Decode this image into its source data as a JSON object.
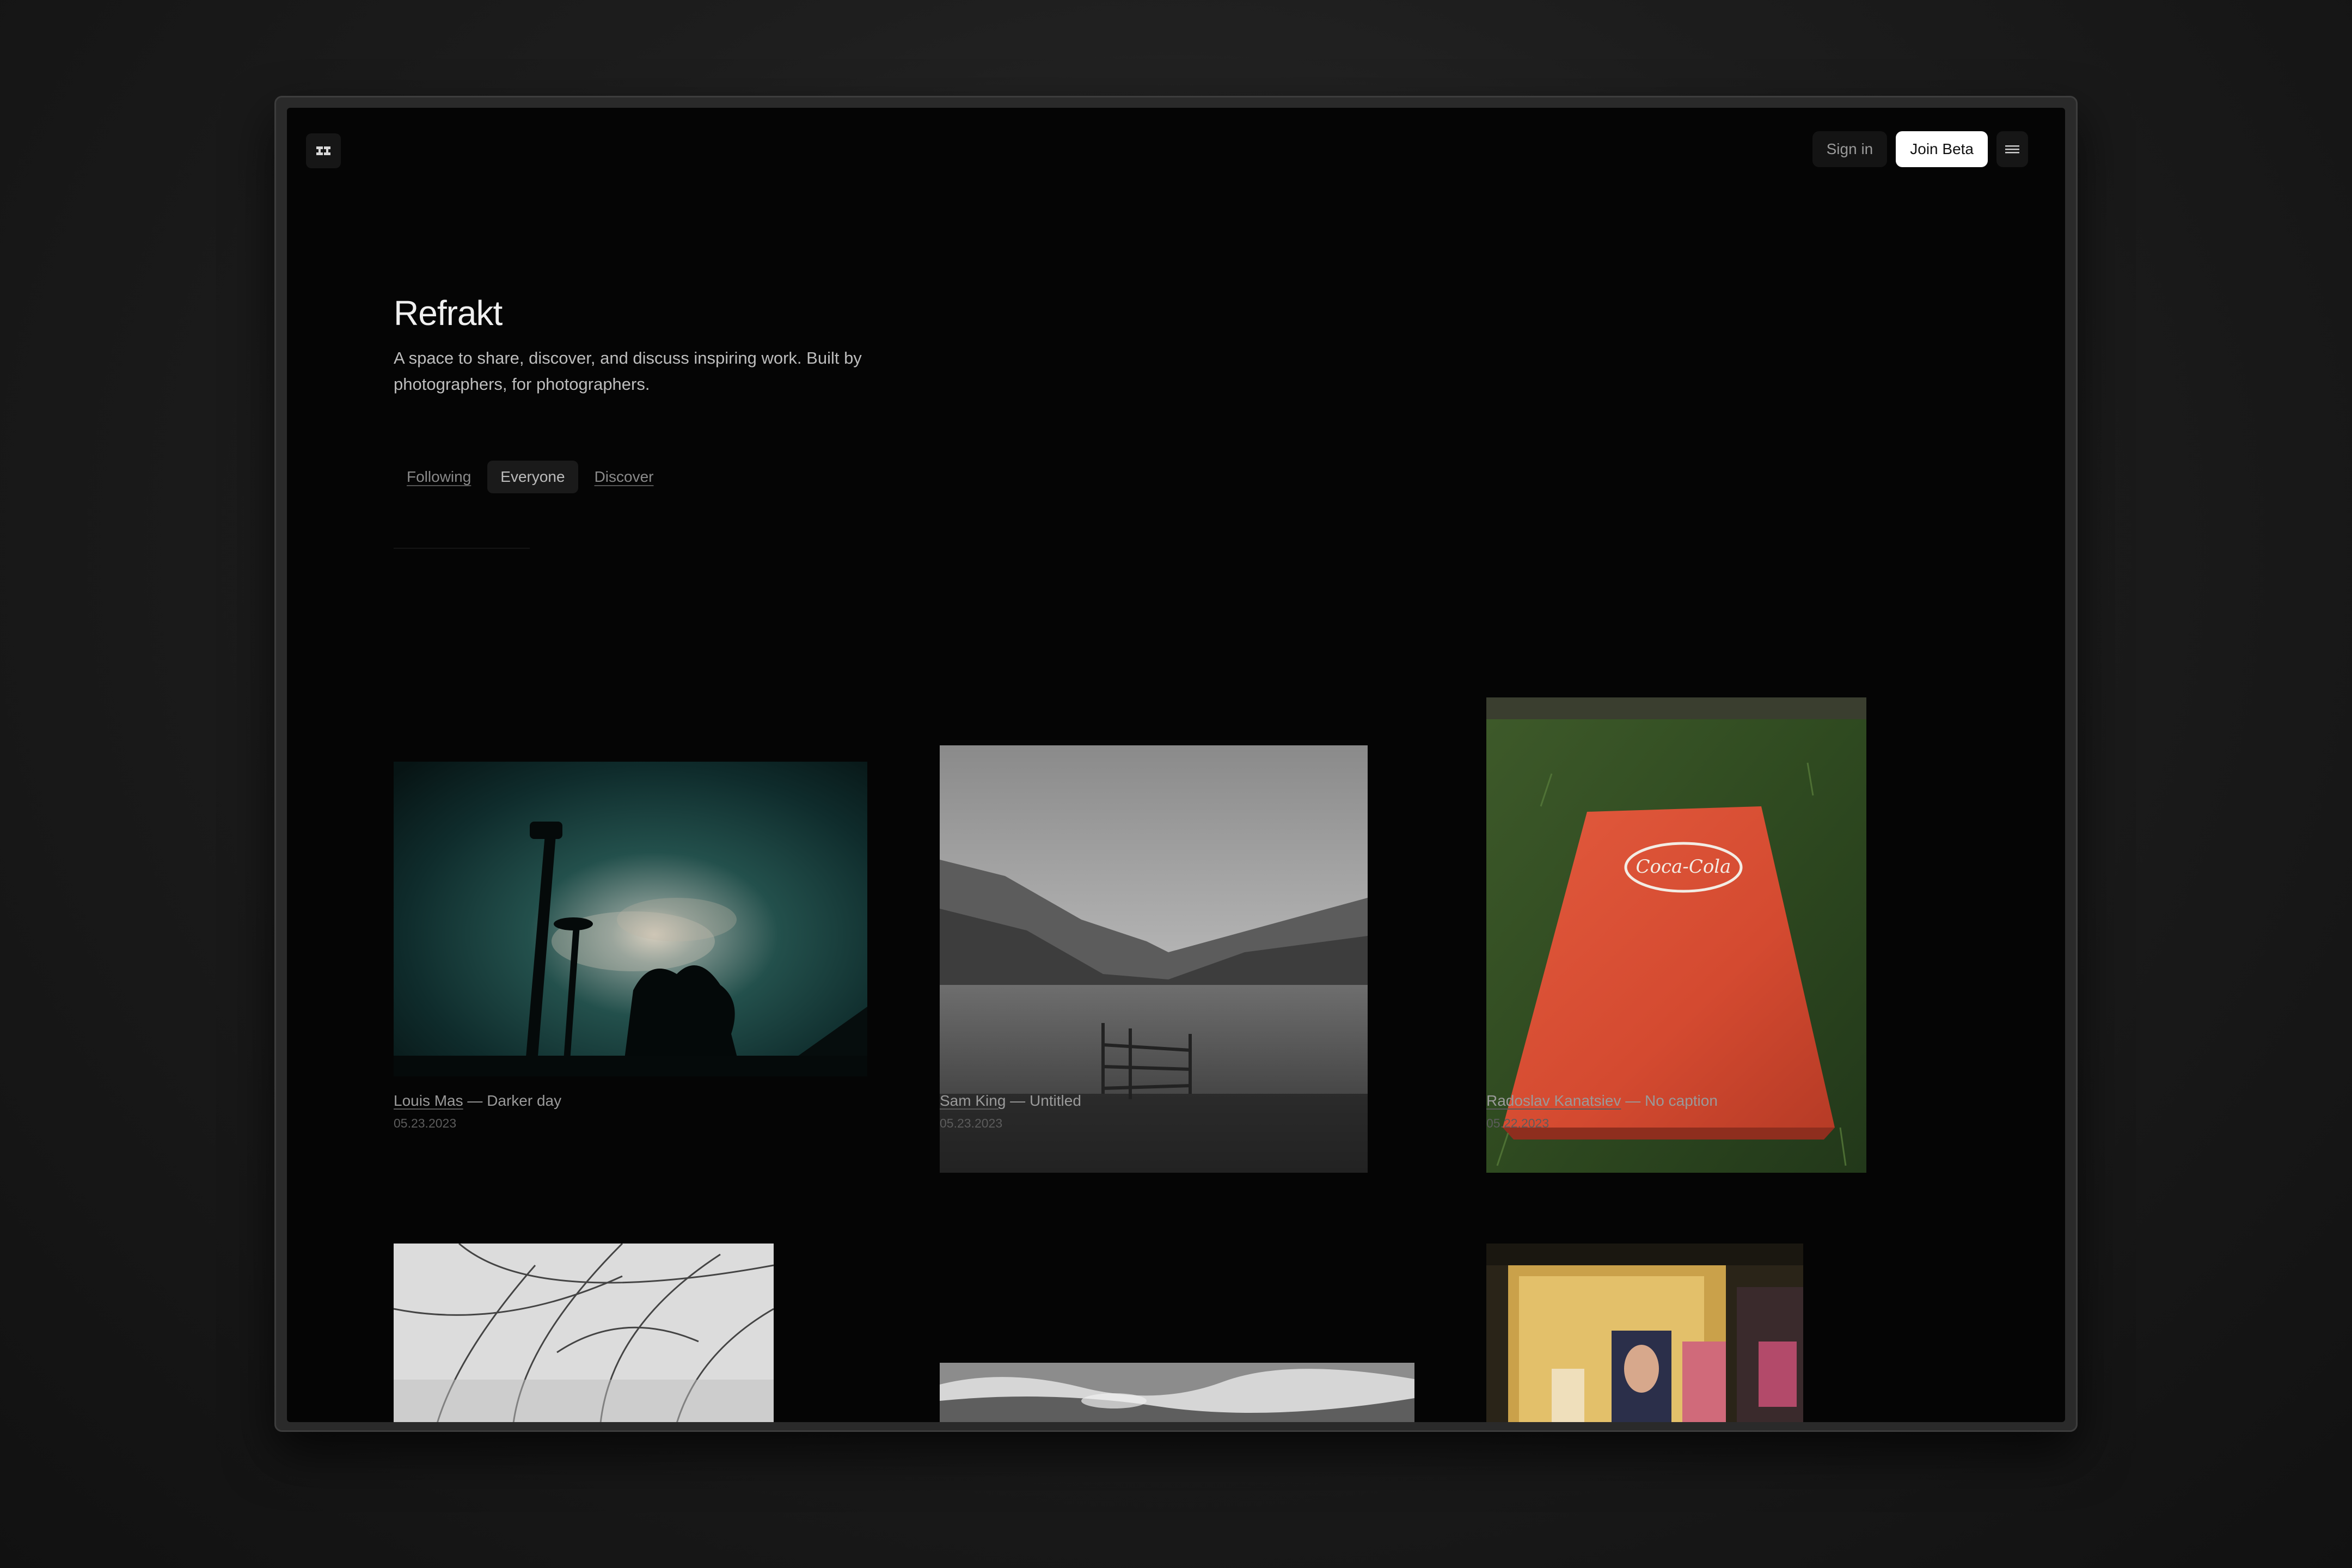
{
  "header": {
    "logo_icon": "refrakt-logo-icon",
    "signin_label": "Sign in",
    "join_label": "Join Beta",
    "menu_icon": "hamburger-menu-icon"
  },
  "hero": {
    "title": "Refrakt",
    "subtitle": "A space to share, discover, and discuss inspiring work. Built by photographers, for photographers."
  },
  "tabs": [
    {
      "label": "Following",
      "active": false
    },
    {
      "label": "Everyone",
      "active": true
    },
    {
      "label": "Discover",
      "active": false
    }
  ],
  "posts": [
    {
      "author": "Louis Mas",
      "separator": " — ",
      "caption": "Darker day",
      "date": "05.23.2023"
    },
    {
      "author": "Sam King",
      "separator": " — ",
      "caption": "Untitled",
      "date": "05.23.2023"
    },
    {
      "author": "Radoslav Kanatsiev",
      "separator": " — ",
      "caption": "No caption",
      "date": "05.22.2023"
    }
  ],
  "photo_labels": {
    "coca_cola": "Coca-Cola"
  },
  "colors": {
    "screen_bg": "#050505",
    "accent_button": "#ffffff",
    "tab_active_bg": "#1a1a1a"
  }
}
